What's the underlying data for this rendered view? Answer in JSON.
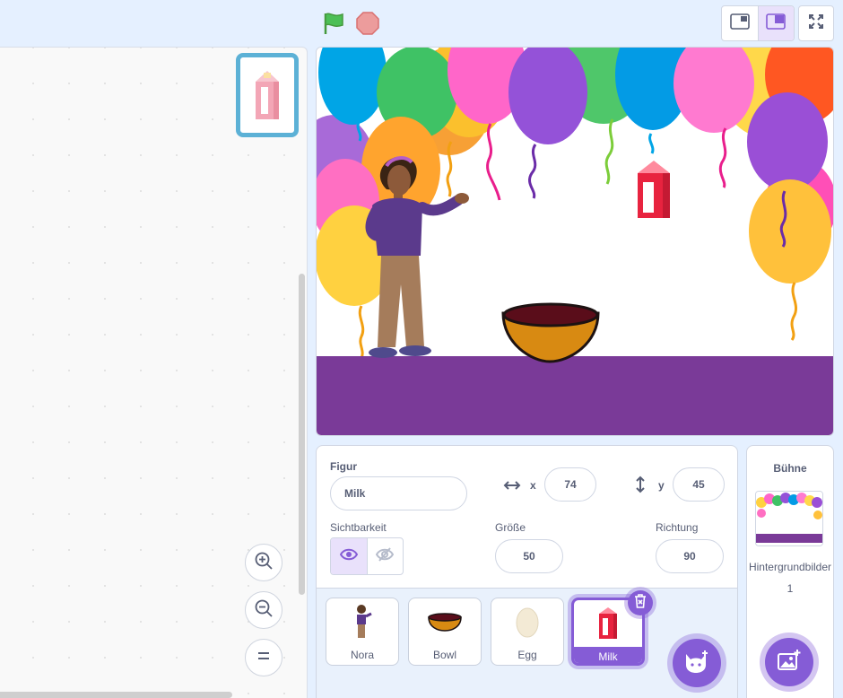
{
  "toolbar": {
    "green_flag_icon": "green-flag-icon",
    "stop_icon": "stop-icon",
    "layout_small_icon": "small-stage-icon",
    "layout_large_icon": "large-stage-icon",
    "fullscreen_icon": "fullscreen-icon",
    "selected_layout": "large"
  },
  "code_area": {
    "current_sprite_thumbnail": "milk-carton",
    "zoom": {
      "zoom_in_icon": "zoom-in-icon",
      "zoom_out_icon": "zoom-out-icon",
      "reset_icon": "zoom-reset-icon"
    }
  },
  "sprite_info": {
    "sprite_label": "Figur",
    "sprite_name": "Milk",
    "x_label": "x",
    "x_value": "74",
    "y_label": "y",
    "y_value": "45",
    "visibility_label": "Sichtbarkeit",
    "visible": true,
    "size_label": "Größe",
    "size_value": "50",
    "direction_label": "Richtung",
    "direction_value": "90"
  },
  "sprites": [
    {
      "name": "Nora",
      "selected": false
    },
    {
      "name": "Bowl",
      "selected": false
    },
    {
      "name": "Egg",
      "selected": false
    },
    {
      "name": "Milk",
      "selected": true
    }
  ],
  "stage_panel": {
    "title": "Bühne",
    "backdrops_label": "Hintergrundbilder",
    "backdrops_count": "1"
  },
  "colors": {
    "accent": "#855cd6",
    "stage_floor": "#7a3a98",
    "code_highlight": "#5cb1d6",
    "flag_green": "#4cbf56",
    "stop_red": "#ec9c9c"
  }
}
